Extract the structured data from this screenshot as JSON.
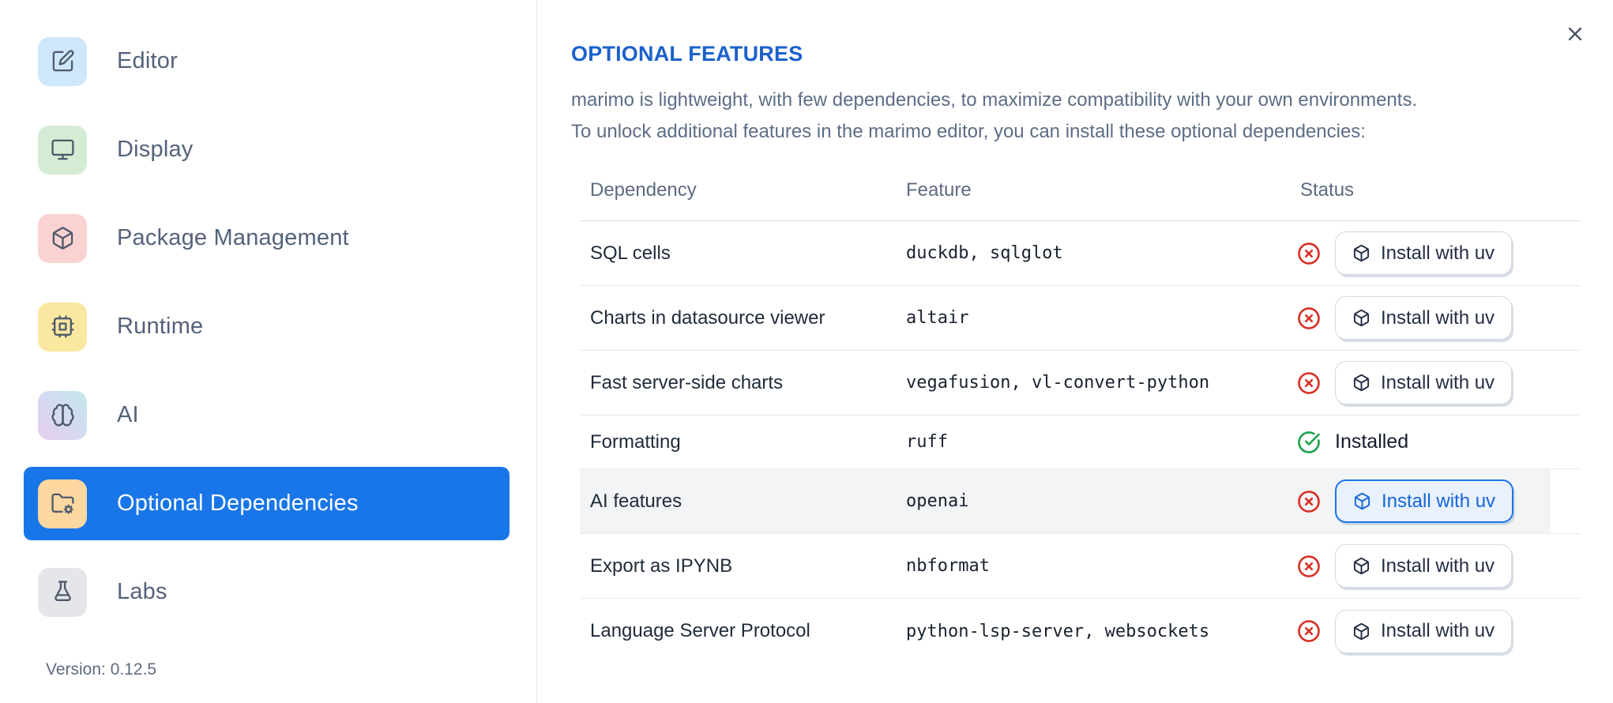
{
  "colors": {
    "accent_blue": "#1976e8",
    "title_blue": "#1b61cb",
    "error_red": "#d93025",
    "success_green": "#1ca24a"
  },
  "sidebar": {
    "items": [
      {
        "label": "Editor",
        "icon": "square-pen-icon",
        "tile_colors": [
          "#cfe7fb"
        ]
      },
      {
        "label": "Display",
        "icon": "monitor-icon",
        "tile_colors": [
          "#d4ecd4"
        ]
      },
      {
        "label": "Package Management",
        "icon": "box-icon",
        "tile_colors": [
          "#fbd2d2"
        ]
      },
      {
        "label": "Runtime",
        "icon": "cpu-icon",
        "tile_colors": [
          "#fbe8a0"
        ]
      },
      {
        "label": "AI",
        "icon": "brain-icon",
        "tile_colors": [
          "#e6cfee",
          "#d4daf1",
          "#c4e6ea"
        ]
      },
      {
        "label": "Optional Dependencies",
        "icon": "folder-cog-icon",
        "tile_colors": [
          "#fcd8a0"
        ],
        "selected": true
      },
      {
        "label": "Labs",
        "icon": "flask-icon",
        "tile_colors": [
          "#e5e6ea"
        ]
      }
    ],
    "version_label": "Version: 0.12.5"
  },
  "main": {
    "title": "OPTIONAL FEATURES",
    "description_lines": [
      "marimo is lightweight, with few dependencies, to maximize compatibility with your own environments.",
      "To unlock additional features in the marimo editor, you can install these optional dependencies:"
    ],
    "close_icon": "close-icon",
    "table": {
      "columns": [
        "Dependency",
        "Feature",
        "Status"
      ],
      "status_icons": {
        "not_installed": "circle-x-icon",
        "installed": "circle-check-icon"
      },
      "install_button_icon": "box-icon",
      "rows": [
        {
          "dependency": "SQL cells",
          "feature": "duckdb, sqlglot",
          "installed": false,
          "action_label": "Install with uv"
        },
        {
          "dependency": "Charts in datasource viewer",
          "feature": "altair",
          "installed": false,
          "action_label": "Install with uv"
        },
        {
          "dependency": "Fast server-side charts",
          "feature": "vegafusion, vl-convert-python",
          "installed": false,
          "action_label": "Install with uv"
        },
        {
          "dependency": "Formatting",
          "feature": "ruff",
          "installed": true,
          "status_label": "Installed"
        },
        {
          "dependency": "AI features",
          "feature": "openai",
          "installed": false,
          "action_label": "Install with uv",
          "highlighted": true
        },
        {
          "dependency": "Export as IPYNB",
          "feature": "nbformat",
          "installed": false,
          "action_label": "Install with uv"
        },
        {
          "dependency": "Language Server Protocol",
          "feature": "python-lsp-server, websockets",
          "installed": false,
          "action_label": "Install with uv"
        }
      ]
    }
  }
}
